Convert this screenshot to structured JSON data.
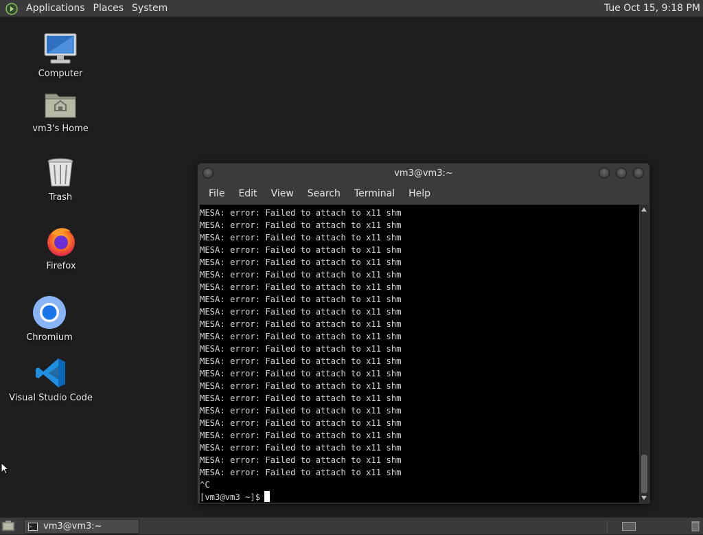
{
  "top_panel": {
    "menus": [
      "Applications",
      "Places",
      "System"
    ],
    "clock": "Tue Oct 15,  9:18 PM"
  },
  "desktop_icons": [
    {
      "label": "Computer",
      "icon": "computer-icon"
    },
    {
      "label": "vm3's Home",
      "icon": "home-folder-icon"
    },
    {
      "label": "Trash",
      "icon": "trash-icon"
    },
    {
      "label": "Firefox",
      "icon": "firefox-icon"
    },
    {
      "label": "Chromium",
      "icon": "chromium-icon"
    },
    {
      "label": "Visual Studio Code",
      "icon": "vscode-icon"
    }
  ],
  "terminal": {
    "title": "vm3@vm3:~",
    "menu": [
      "File",
      "Edit",
      "View",
      "Search",
      "Terminal",
      "Help"
    ],
    "lines": [
      "MESA: error: Failed to attach to x11 shm",
      "MESA: error: Failed to attach to x11 shm",
      "MESA: error: Failed to attach to x11 shm",
      "MESA: error: Failed to attach to x11 shm",
      "MESA: error: Failed to attach to x11 shm",
      "MESA: error: Failed to attach to x11 shm",
      "MESA: error: Failed to attach to x11 shm",
      "MESA: error: Failed to attach to x11 shm",
      "MESA: error: Failed to attach to x11 shm",
      "MESA: error: Failed to attach to x11 shm",
      "MESA: error: Failed to attach to x11 shm",
      "MESA: error: Failed to attach to x11 shm",
      "MESA: error: Failed to attach to x11 shm",
      "MESA: error: Failed to attach to x11 shm",
      "MESA: error: Failed to attach to x11 shm",
      "MESA: error: Failed to attach to x11 shm",
      "MESA: error: Failed to attach to x11 shm",
      "MESA: error: Failed to attach to x11 shm",
      "MESA: error: Failed to attach to x11 shm",
      "MESA: error: Failed to attach to x11 shm",
      "MESA: error: Failed to attach to x11 shm",
      "MESA: error: Failed to attach to x11 shm",
      "^C"
    ],
    "prompt": "[vm3@vm3 ~]$"
  },
  "taskbar": {
    "task_label": "vm3@vm3:~"
  }
}
